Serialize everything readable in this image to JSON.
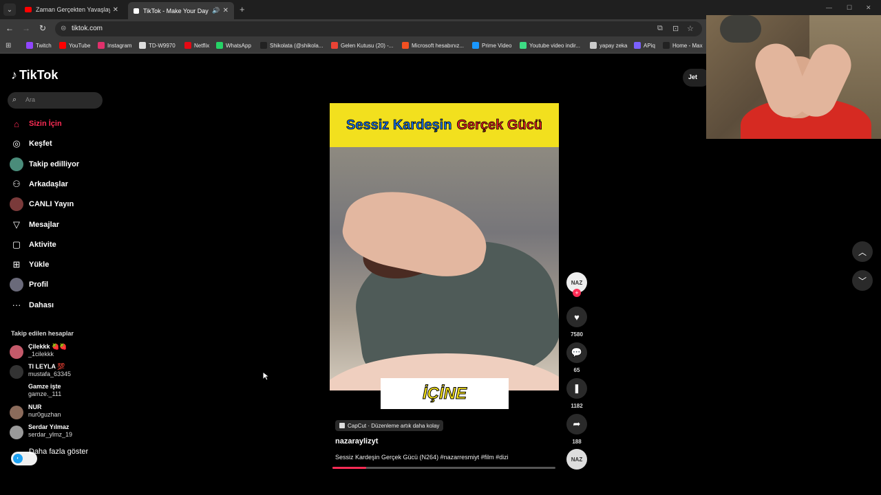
{
  "browser": {
    "tabs": [
      {
        "title": "Zaman Gerçekten Yavaşlayabilir",
        "active": false,
        "favicon_color": "#ff0000"
      },
      {
        "title": "TikTok - Make Your Day",
        "active": true,
        "favicon_color": "#ffffff"
      }
    ],
    "new_tab_icon": "+",
    "url": "tiktok.com",
    "bookmarks": [
      {
        "label": "Twitch",
        "color": "#9146ff"
      },
      {
        "label": "YouTube",
        "color": "#ff0000"
      },
      {
        "label": "Instagram",
        "color": "#e1306c"
      },
      {
        "label": "TD-W9970",
        "color": "#dddddd"
      },
      {
        "label": "Netflix",
        "color": "#e50914"
      },
      {
        "label": "WhatsApp",
        "color": "#25d366"
      },
      {
        "label": "Shikolata (@shikola...",
        "color": "#222222"
      },
      {
        "label": "Gelen Kutusu (20) -...",
        "color": "#ea4335"
      },
      {
        "label": "Microsoft hesabınız...",
        "color": "#f25022"
      },
      {
        "label": "Prime Video",
        "color": "#1a98ff"
      },
      {
        "label": "Youtube video indir...",
        "color": "#3ddc84"
      },
      {
        "label": "yapay zeka",
        "color": "#cccccc"
      },
      {
        "label": "APiq",
        "color": "#7b61ff"
      },
      {
        "label": "Home - Max",
        "color": "#222222"
      }
    ]
  },
  "tiktok": {
    "logo_text": "TikTok",
    "search_placeholder": "Ara",
    "nav": [
      {
        "label": "Sizin İçin",
        "icon": "home-icon",
        "active": true
      },
      {
        "label": "Keşfet",
        "icon": "compass-icon",
        "active": false
      },
      {
        "label": "Takip edilliyor",
        "icon": "following-avatar",
        "active": false
      },
      {
        "label": "Arkadaşlar",
        "icon": "friends-icon",
        "active": false
      },
      {
        "label": "CANLI Yayın",
        "icon": "live-avatar",
        "active": false
      },
      {
        "label": "Mesajlar",
        "icon": "send-icon",
        "active": false
      },
      {
        "label": "Aktivite",
        "icon": "activity-icon",
        "active": false
      },
      {
        "label": "Yükle",
        "icon": "upload-icon",
        "active": false
      },
      {
        "label": "Profil",
        "icon": "profile-avatar",
        "active": false
      },
      {
        "label": "Dahası",
        "icon": "more-icon",
        "active": false
      }
    ],
    "following_header": "Takip edilen hesaplar",
    "following": [
      {
        "name": "Çilekkk 🍓🍓",
        "user": "_1cilekkk",
        "color": "#c45a6a"
      },
      {
        "name": "TI LEYLA 💯",
        "user": "mustafa_63345",
        "color": "#333333"
      },
      {
        "name": "Gamze işte",
        "user": "gamze._111",
        "color": "#000000"
      },
      {
        "name": "NUR",
        "user": "nur0guzhan",
        "color": "#8b6b5b"
      },
      {
        "name": "Serdar Yılmaz",
        "user": "serdar_ylmz_19",
        "color": "#9a9a9a"
      }
    ],
    "show_more": "Daha fazla göster",
    "get_app": "Jet"
  },
  "video": {
    "banner_word1": "Sessiz Kardeşin",
    "banner_word2": "Gerçek Gücü",
    "caption": "İÇİNE",
    "capcut_label": "CapCut · Düzenleme artık daha kolay",
    "author": "nazaraylizyt",
    "description": "Sessiz Kardeşin Gerçek Gücü (N264) #nazarresmiyt #film #dizi",
    "progress_percent": 15,
    "likes": "7580",
    "comments": "65",
    "saves": "1182",
    "shares": "188",
    "avatar_text": "NAZ"
  }
}
